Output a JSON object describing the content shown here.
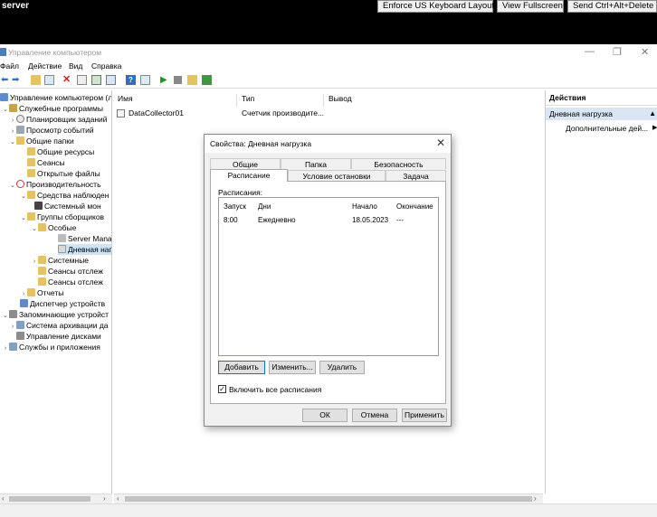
{
  "session": {
    "server": "server",
    "buttons": [
      "Enforce US Keyboard Layout",
      "View Fullscreen",
      "Send Ctrl+Alt+Delete"
    ]
  },
  "window": {
    "title": "Управление компьютером"
  },
  "menu": [
    "Файл",
    "Действие",
    "Вид",
    "Справка"
  ],
  "tree": [
    {
      "label": "Управление компьютером (л",
      "icon": "computer-icon"
    },
    {
      "label": "Служебные программы",
      "icon": "tools-icon"
    },
    {
      "label": "Планировщик заданий",
      "icon": "clock-icon"
    },
    {
      "label": "Просмотр событий",
      "icon": "event-log-icon"
    },
    {
      "label": "Общие папки",
      "icon": "shared-folder-icon"
    },
    {
      "label": "Общие ресурсы",
      "icon": "folder-icon"
    },
    {
      "label": "Сеансы",
      "icon": "folder-icon"
    },
    {
      "label": "Открытые файлы",
      "icon": "folder-icon"
    },
    {
      "label": "Производительность",
      "icon": "performance-icon"
    },
    {
      "label": "Средства наблюден",
      "icon": "folder-icon"
    },
    {
      "label": "Системный мон",
      "icon": "monitor-icon"
    },
    {
      "label": "Группы сборщиков",
      "icon": "folder-icon"
    },
    {
      "label": "Особые",
      "icon": "folder-icon"
    },
    {
      "label": "Server Manac",
      "icon": "gear-icon"
    },
    {
      "label": "Дневная наг",
      "icon": "collector-icon"
    },
    {
      "label": "Системные",
      "icon": "folder-icon"
    },
    {
      "label": "Сеансы отслеж",
      "icon": "folder-icon"
    },
    {
      "label": "Сеансы отслеж",
      "icon": "folder-icon"
    },
    {
      "label": "Отчеты",
      "icon": "folder-icon"
    },
    {
      "label": "Диспетчер устройств",
      "icon": "device-manager-icon"
    },
    {
      "label": "Запоминающие устройст",
      "icon": "storage-icon"
    },
    {
      "label": "Система архивации да",
      "icon": "backup-icon"
    },
    {
      "label": "Управление дисками",
      "icon": "disk-icon"
    },
    {
      "label": "Службы и приложения",
      "icon": "services-icon"
    }
  ],
  "list": {
    "columns": [
      "Имя",
      "Тип",
      "Вывод"
    ],
    "rows": [
      {
        "name": "DataCollector01",
        "type": "Счетчик производите...",
        "output": ""
      }
    ]
  },
  "actions": {
    "header": "Действия",
    "section": "Дневная нагрузка",
    "more": "Дополнительные дей..."
  },
  "dialog": {
    "title": "Свойства: Дневная нагрузка",
    "tabs_row1": [
      "Общие",
      "Папка",
      "Безопасность"
    ],
    "tabs_row2": [
      "Расписание",
      "Условие остановки",
      "Задача"
    ],
    "schedules_label": "Расписания:",
    "columns": [
      "Запуск",
      "Дни",
      "Начало",
      "Окончание"
    ],
    "rows": [
      {
        "start": "8:00",
        "days": "Ежедневно",
        "begin": "18.05.2023",
        "end": "---"
      }
    ],
    "add": "Добавить",
    "edit": "Изменить...",
    "delete": "Удалить",
    "enable_all": "Включить все расписания",
    "ok": "ОК",
    "cancel": "Отмена",
    "apply": "Применить"
  }
}
